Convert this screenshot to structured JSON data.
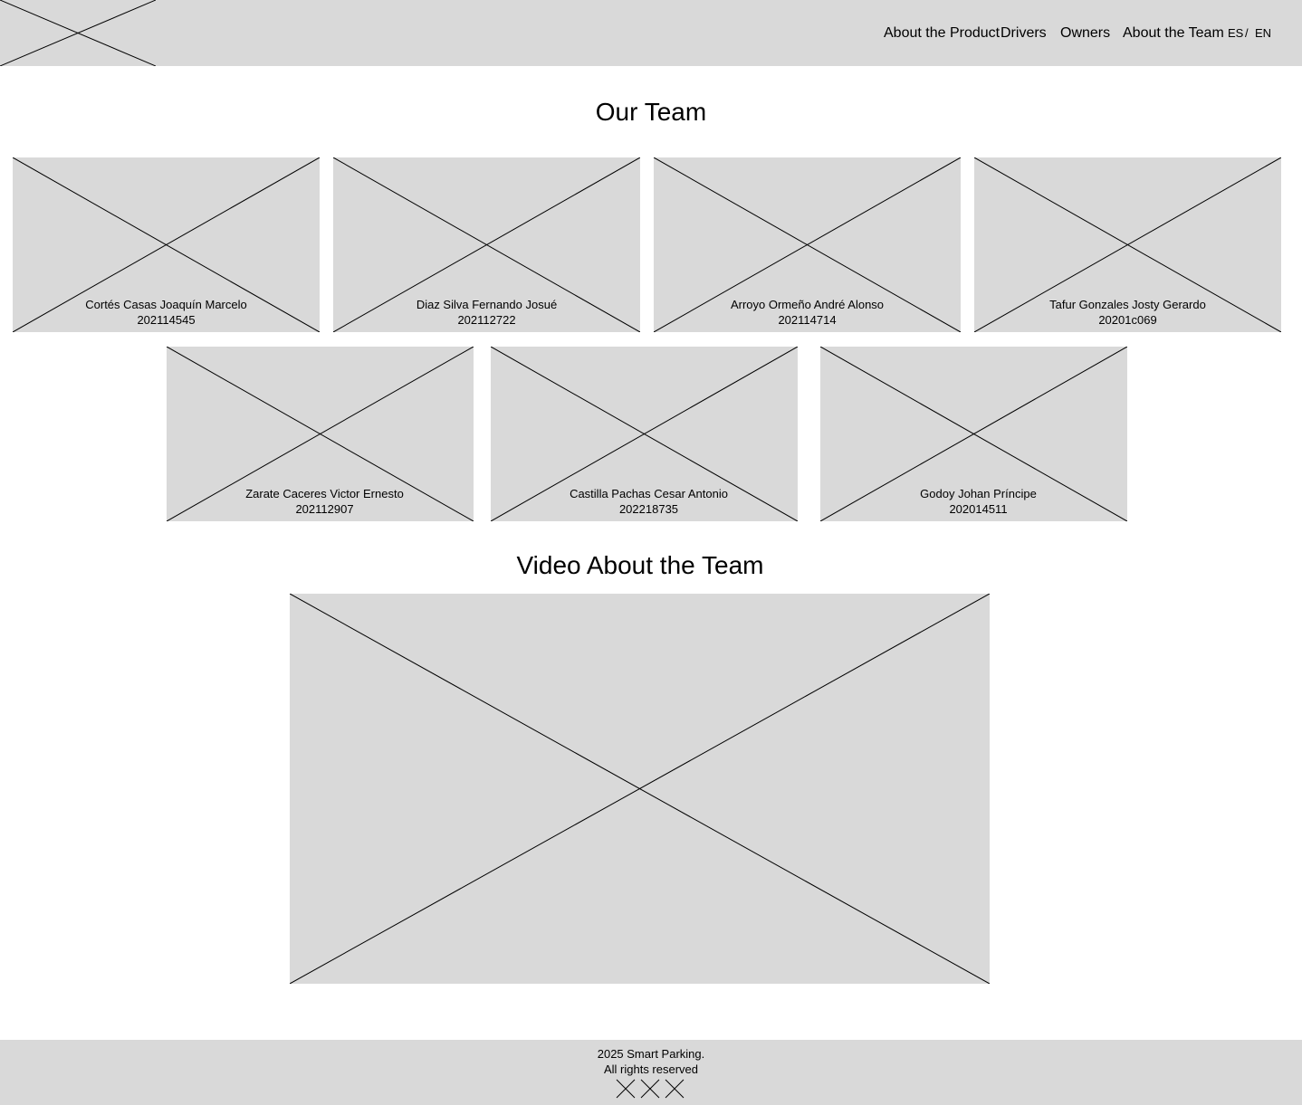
{
  "header": {
    "logo_icon": "image-placeholder-icon",
    "nav": [
      {
        "label": "About the Product"
      },
      {
        "label": "Drivers"
      },
      {
        "label": "Owners"
      },
      {
        "label": "About the Team"
      }
    ],
    "language": {
      "es": "ES",
      "separator": "/",
      "en": "EN"
    }
  },
  "team": {
    "title": "Our Team",
    "members": [
      {
        "name": "Cortés Casas Joaquín Marcelo",
        "code": "202114545"
      },
      {
        "name": "Diaz Silva Fernando Josué",
        "code": "202112722"
      },
      {
        "name": "Arroyo Ormeño André Alonso",
        "code": "202114714"
      },
      {
        "name": "Tafur Gonzales Josty Gerardo",
        "code": "20201c069"
      },
      {
        "name": "Zarate Caceres Victor Ernesto",
        "code": "202112907"
      },
      {
        "name": "Castilla Pachas Cesar Antonio",
        "code": "202218735"
      },
      {
        "name": "Godoy Johan Príncipe",
        "code": "202014511"
      }
    ]
  },
  "video": {
    "title": "Video About the Team",
    "icon": "video-placeholder-icon"
  },
  "footer": {
    "copyright": "2025 Smart Parking.",
    "rights": "All rights reserved",
    "social_icons": [
      "social-icon",
      "social-icon",
      "social-icon"
    ]
  },
  "colors": {
    "placeholder_bg": "#d9d9d9",
    "page_bg": "#ffffff",
    "text": "#000000"
  }
}
